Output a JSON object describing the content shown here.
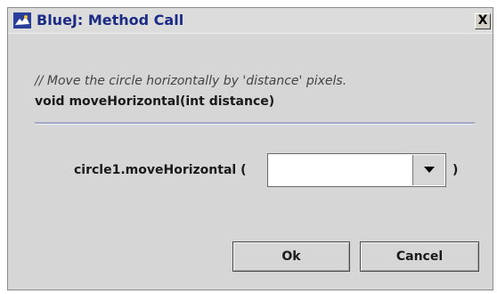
{
  "window": {
    "title": "BlueJ: Method Call",
    "close_glyph": "X"
  },
  "method": {
    "comment": "// Move the circle horizontally by 'distance' pixels.",
    "signature": "void moveHorizontal(int distance)"
  },
  "call": {
    "prefix": "circle1.moveHorizontal (",
    "argument_value": "",
    "suffix": ")"
  },
  "buttons": {
    "ok_label": "Ok",
    "cancel_label": "Cancel"
  },
  "colors": {
    "title_text": "#1c2c84",
    "dialog_bg": "#d6d6d6",
    "divider": "#a4a9c6"
  },
  "icons": {
    "app": "bluej-bird-icon",
    "close": "close-icon",
    "dropdown": "chevron-down-icon"
  }
}
